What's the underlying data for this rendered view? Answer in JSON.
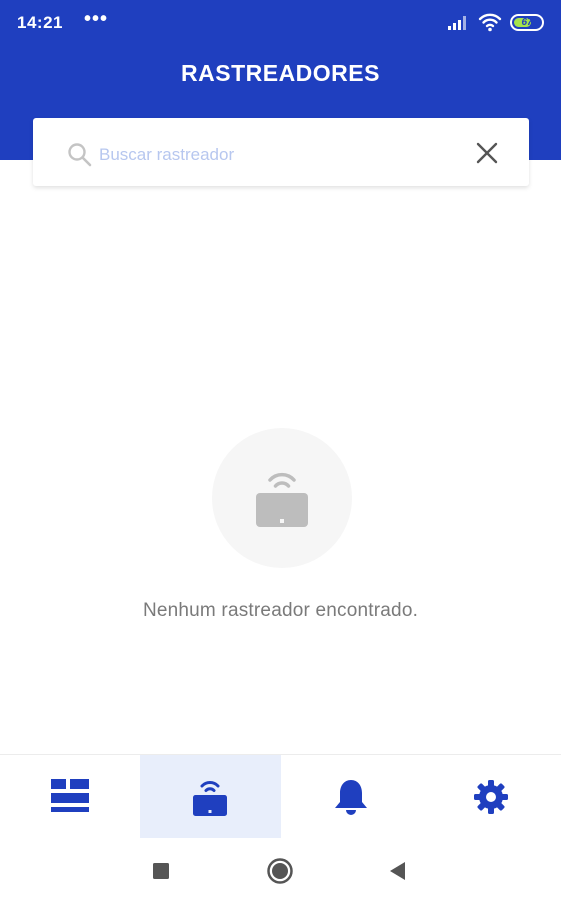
{
  "status_bar": {
    "time": "14:21",
    "notifications": "•••",
    "battery_level": "67",
    "icons": [
      "signal-icon",
      "wifi-icon",
      "battery-icon"
    ]
  },
  "header": {
    "title": "RASTREADORES"
  },
  "search": {
    "placeholder": "Buscar rastreador",
    "value": "",
    "icons": [
      "search-icon",
      "close-icon"
    ]
  },
  "empty_state": {
    "icon": "tracker-icon",
    "message": "Nenhum rastreador encontrado."
  },
  "bottom_nav": {
    "tabs": [
      {
        "icon": "dashboard-icon",
        "active": false
      },
      {
        "icon": "tracker-icon",
        "active": true
      },
      {
        "icon": "bell-icon",
        "active": false
      },
      {
        "icon": "gear-icon",
        "active": false
      }
    ]
  },
  "system_nav": {
    "buttons": [
      "recents-icon",
      "home-icon",
      "back-icon"
    ]
  },
  "colors": {
    "primary": "#1f3fbf",
    "active_tab_bg": "#e8eefb",
    "placeholder": "#b7c7ef",
    "empty_text": "#7a7a7a",
    "empty_icon": "#bdbdbd",
    "battery_fill": "#a6e34a"
  }
}
